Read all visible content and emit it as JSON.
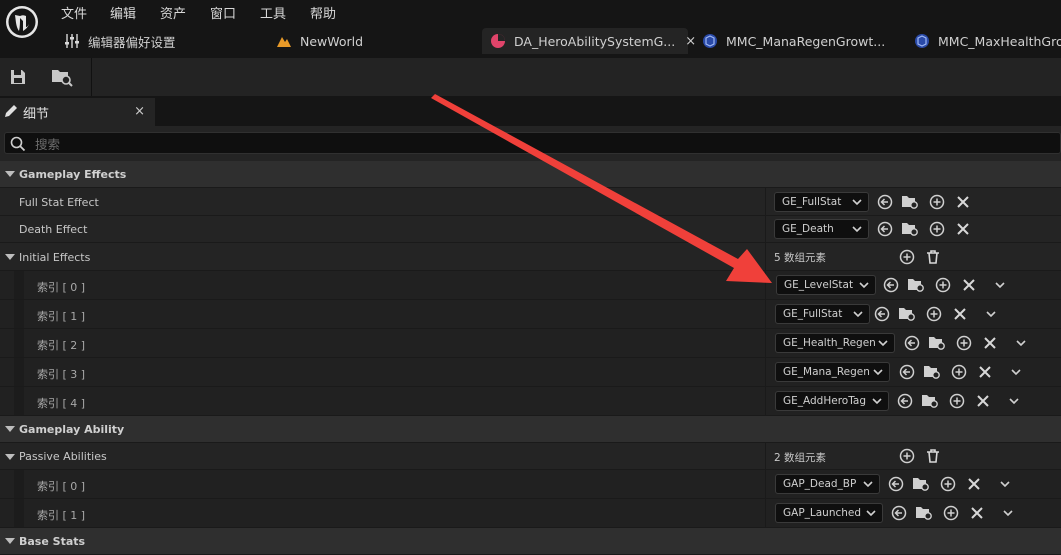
{
  "menu": [
    "文件",
    "编辑",
    "资产",
    "窗口",
    "工具",
    "帮助"
  ],
  "tabs": [
    {
      "label": "编辑器偏好设置",
      "icon": "sliders-icon"
    },
    {
      "label": "NewWorld",
      "icon": "level-icon"
    },
    {
      "label": "DA_HeroAbilitySystemG...",
      "icon": "data-asset-icon",
      "close": "×"
    },
    {
      "label": "MMC_ManaRegenGrowt...",
      "icon": "blueprint-icon"
    },
    {
      "label": "MMC_MaxHealthGrow",
      "icon": "blueprint-icon"
    }
  ],
  "panel": {
    "title": "细节",
    "close": "×"
  },
  "search": {
    "placeholder": "搜索"
  },
  "categories": {
    "gameplay_effects": "Gameplay Effects",
    "gameplay_ability": "Gameplay Ability",
    "base_stats": "Base Stats"
  },
  "rows": {
    "full_stat_effect": {
      "label": "Full Stat Effect",
      "value": "GE_FullStat"
    },
    "death_effect": {
      "label": "Death Effect",
      "value": "GE_Death"
    },
    "initial_effects": {
      "label": "Initial Effects",
      "count": "5 数组元素",
      "items": [
        {
          "index": "索引 [ 0 ]",
          "value": "GE_LevelStat"
        },
        {
          "index": "索引 [ 1 ]",
          "value": "GE_FullStat"
        },
        {
          "index": "索引 [ 2 ]",
          "value": "GE_Health_Regen"
        },
        {
          "index": "索引 [ 3 ]",
          "value": "GE_Mana_Regen"
        },
        {
          "index": "索引 [ 4 ]",
          "value": "GE_AddHeroTag"
        }
      ]
    },
    "passive_abilities": {
      "label": "Passive Abilities",
      "count": "2 数组元素",
      "items": [
        {
          "index": "索引 [ 0 ]",
          "value": "GAP_Dead_BP"
        },
        {
          "index": "索引 [ 1 ]",
          "value": "GAP_Launched"
        }
      ]
    }
  },
  "colors": {
    "annotation_arrow": "#f0403a",
    "data_asset_icon": "#e0446a",
    "level_icon": "#e89a28",
    "blueprint_icon": "#5a7fd8"
  }
}
